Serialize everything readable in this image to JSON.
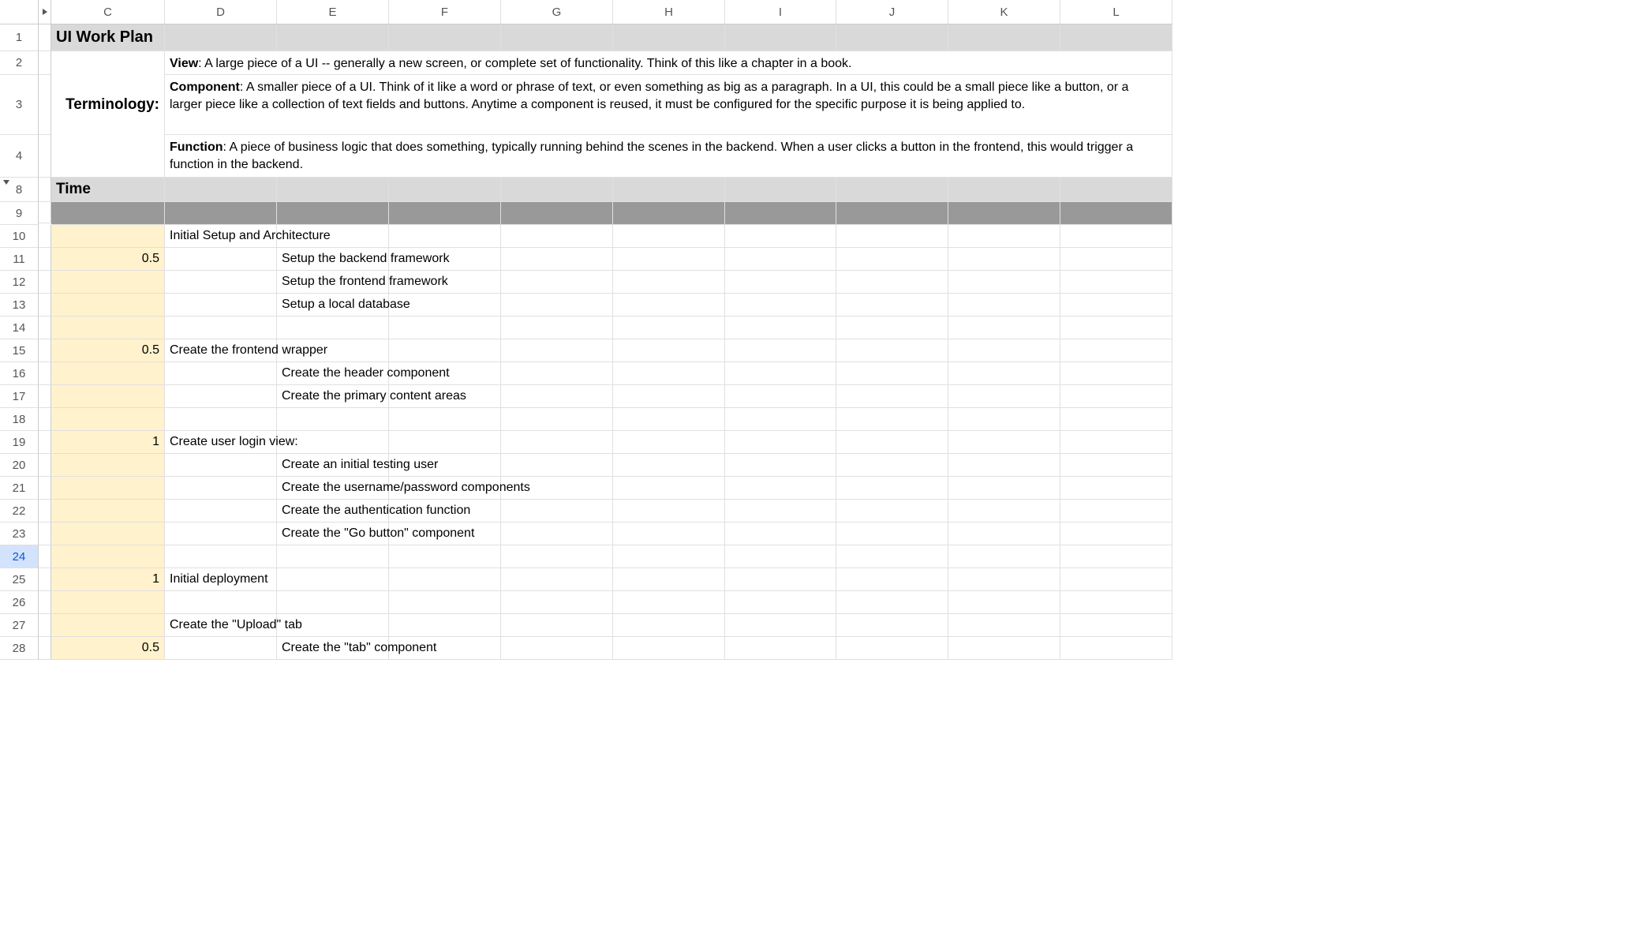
{
  "columns": [
    "C",
    "D",
    "E",
    "F",
    "G",
    "H",
    "I",
    "J",
    "K",
    "L"
  ],
  "row_numbers": [
    "1",
    "2",
    "3",
    "4",
    "8",
    "9",
    "10",
    "11",
    "12",
    "13",
    "14",
    "15",
    "16",
    "17",
    "18",
    "19",
    "20",
    "21",
    "22",
    "23",
    "24",
    "25",
    "26",
    "27",
    "28"
  ],
  "title": "UI Work Plan",
  "terminology_label": "Terminology:",
  "view_term": "View",
  "view_def": ": A large piece of a UI -- generally a new screen, or complete set of functionality. Think of this like a chapter in a book.",
  "component_term": "Component",
  "component_def": ": A smaller piece of a UI. Think of it like a word or phrase of text, or even something as big as a paragraph. In a UI, this could be a small piece like a button, or a larger piece like a collection of text fields and buttons. Anytime a component is reused, it must be configured for the specific purpose it is being applied to.",
  "function_term": "Function",
  "function_def": ": A piece of business logic that does something, typically running behind the scenes in the backend. When a user clicks a button in the frontend, this would trigger a function in the backend.",
  "time_header": "Time",
  "rows": {
    "r10": {
      "d": "Initial Setup and Architecture"
    },
    "r11": {
      "c": "0.5",
      "e": "Setup the backend framework"
    },
    "r12": {
      "e": "Setup the frontend framework"
    },
    "r13": {
      "e": "Setup a local database"
    },
    "r15": {
      "c": "0.5",
      "d": "Create the frontend wrapper"
    },
    "r16": {
      "e": "Create the header component"
    },
    "r17": {
      "e": "Create the primary content areas"
    },
    "r19": {
      "c": "1",
      "d": "Create user login view:"
    },
    "r20": {
      "e": "Create an initial testing user"
    },
    "r21": {
      "e": "Create the username/password components"
    },
    "r22": {
      "e": "Create the authentication function"
    },
    "r23": {
      "e": "Create the \"Go button\" component"
    },
    "r25": {
      "c": "1",
      "d": "Initial deployment"
    },
    "r27": {
      "d": "Create the \"Upload\" tab"
    },
    "r28": {
      "c": "0.5",
      "e": "Create the \"tab\" component"
    }
  }
}
